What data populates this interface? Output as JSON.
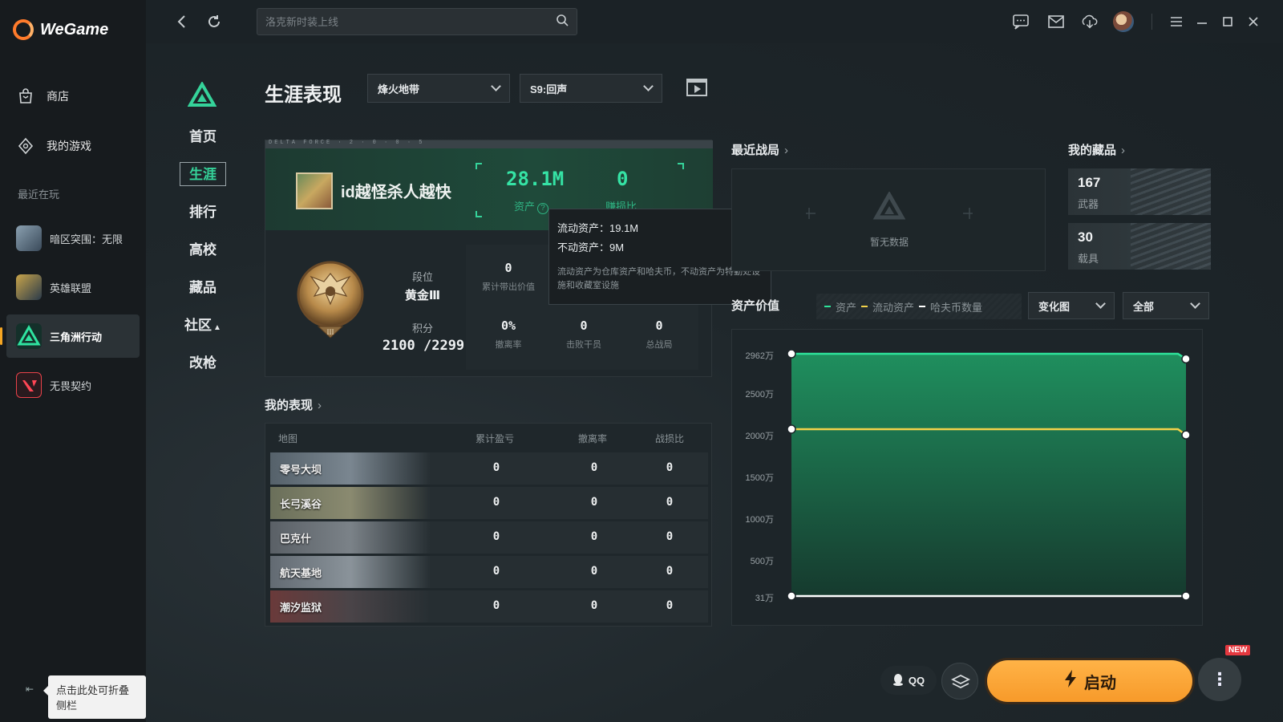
{
  "app": {
    "name": "WeGame"
  },
  "sidebar": {
    "nav": [
      {
        "label": "商店",
        "icon": "store-bag-icon"
      },
      {
        "label": "我的游戏",
        "icon": "my-games-icon"
      }
    ],
    "recent_title": "最近在玩",
    "games": [
      {
        "label": "暗区突围：无限",
        "icon": "arena-breakout-icon"
      },
      {
        "label": "英雄联盟",
        "icon": "league-of-legends-icon"
      },
      {
        "label": "三角洲行动",
        "icon": "delta-force-icon"
      },
      {
        "label": "无畏契约",
        "icon": "valorant-icon"
      }
    ],
    "collapse_tip": "点击此处可折叠侧栏"
  },
  "topbar": {
    "search_placeholder": "洛克新时装上线"
  },
  "game_nav": {
    "items": [
      "首页",
      "生涯",
      "排行",
      "高校",
      "藏品",
      "社区",
      "改枪"
    ],
    "active": "生涯"
  },
  "header": {
    "title": "生涯表现",
    "mode_select": "烽火地带",
    "season_select": "S9:回声"
  },
  "profile": {
    "strip_label": "DELTA FORCE · 2 · 0 · 0 · 5",
    "player_name": "id越怪杀人越快",
    "asset_value": "28.1M",
    "asset_label": "资产",
    "ratio_value": "0",
    "ratio_label": "赚损比",
    "rank_label": "段位",
    "rank_value": "黄金Ⅲ",
    "score_label": "积分",
    "score_value": "2100 /2299",
    "stats": [
      {
        "value": "0",
        "label": "累计带出价值"
      },
      {
        "value": "0%",
        "label": "撤离率"
      },
      {
        "value": "0",
        "label": "击败干员"
      },
      {
        "value": "0",
        "label": "总战局"
      }
    ]
  },
  "asset_tooltip": {
    "liquid": "流动资产：19.1M",
    "fixed": "不动资产：9M",
    "note": "流动资产为仓库资产和哈夫币，不动资产为特勤处设施和收藏室设施"
  },
  "performance": {
    "title": "我的表现",
    "columns": [
      "地图",
      "累计盈亏",
      "撤离率",
      "战损比"
    ],
    "rows": [
      {
        "map": "零号大坝",
        "profit": "0",
        "evac": "0",
        "kd": "0"
      },
      {
        "map": "长弓溪谷",
        "profit": "0",
        "evac": "0",
        "kd": "0"
      },
      {
        "map": "巴克什",
        "profit": "0",
        "evac": "0",
        "kd": "0"
      },
      {
        "map": "航天基地",
        "profit": "0",
        "evac": "0",
        "kd": "0"
      },
      {
        "map": "潮汐监狱",
        "profit": "0",
        "evac": "0",
        "kd": "0"
      }
    ]
  },
  "recent_battles": {
    "title": "最近战局",
    "empty": "暂无数据"
  },
  "collections": {
    "title": "我的藏品",
    "items": [
      {
        "count": "167",
        "label": "武器"
      },
      {
        "count": "30",
        "label": "载具"
      }
    ]
  },
  "asset_chart": {
    "title": "资产价值",
    "legend": [
      "资产",
      "流动资产",
      "哈夫币数量"
    ],
    "view_select": "变化图",
    "range_select": "全部",
    "colors": {
      "asset": "#2ee39a",
      "liquid": "#f2d24a",
      "coins": "#ffffff"
    }
  },
  "chart_data": {
    "type": "area",
    "title": "资产价值",
    "y_tick_labels": [
      "2962万",
      "2500万",
      "2000万",
      "1500万",
      "1000万",
      "500万",
      "31万"
    ],
    "ylim": [
      31,
      2962
    ],
    "series": [
      {
        "name": "资产",
        "values": [
          2962,
          2962,
          2900
        ]
      },
      {
        "name": "流动资产",
        "values": [
          2050,
          2050,
          1980
        ]
      },
      {
        "name": "哈夫币数量",
        "values": [
          31,
          31,
          31
        ]
      }
    ]
  },
  "bottom": {
    "qq_label": "QQ",
    "launch_label": "启动",
    "new_badge": "NEW"
  }
}
